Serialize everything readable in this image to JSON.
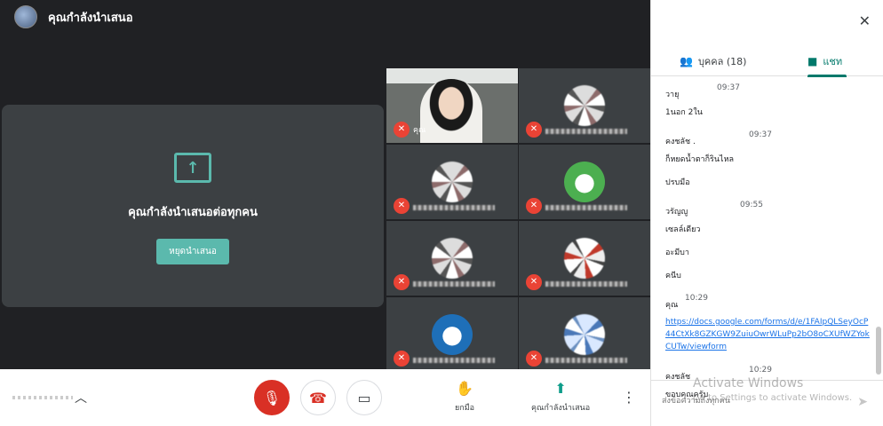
{
  "meeting": {
    "presenting_title": "คุณกำลังนำเสนอ",
    "present_message": "คุณกำลังนำเสนอต่อทุกคน",
    "stop_button": "หยุดนำเสนอ"
  },
  "tiles": [
    {
      "kind": "self",
      "name": "คุณ",
      "muted": true
    },
    {
      "kind": "blurred",
      "muted": true
    },
    {
      "kind": "blurred",
      "muted": true
    },
    {
      "kind": "avatar-green",
      "muted": true
    },
    {
      "kind": "blurred",
      "muted": true
    },
    {
      "kind": "blurred-red",
      "muted": true
    },
    {
      "kind": "avatar-blue",
      "muted": true
    },
    {
      "kind": "blurred-blue",
      "muted": true
    }
  ],
  "toolbar": {
    "raise_hand_label": "ยกมือ",
    "present_label": "คุณกำลังนำเสนอ"
  },
  "panel": {
    "people_tab": "บุคคล (18)",
    "chat_tab": "แชท",
    "compose_placeholder": "ส่งข้อความถึงทุกคน"
  },
  "messages": [
    {
      "sender": "วายุ",
      "time": "09:37",
      "lines": [
        "1นอก 2ใน"
      ]
    },
    {
      "sender": "คงชลัช .",
      "time": "09:37",
      "lines": [
        "ก็หยดน้ำตาก็รินไหล",
        "ปรบมือ"
      ]
    },
    {
      "sender": "วรัญญู",
      "time": "09:55",
      "lines": [
        "เซลล์เดียว",
        "อะมีบา",
        "คนีบ"
      ]
    },
    {
      "sender": "คุณ",
      "time": "10:29",
      "link": "https://docs.google.com/forms/d/e/1FAIpQLSeyOcP44CtXk8GZKGW9ZuiuOwrWLuPp2bO8oCXUfWZYokCUTw/viewform"
    },
    {
      "sender": "คงชลัช",
      "time": "10:29",
      "lines": [
        "ขอบคุณครับ"
      ]
    }
  ],
  "watermark": {
    "line1": "Activate Windows",
    "line2": "Go to Settings to activate Windows."
  },
  "colors": {
    "accent": "#5bb9ad",
    "chat_tab": "#00796b",
    "danger": "#d93025",
    "link": "#1a73e8"
  }
}
